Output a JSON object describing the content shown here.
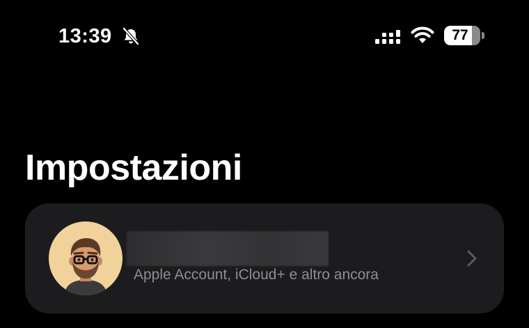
{
  "status_bar": {
    "time": "13:39",
    "silent_icon": "bell-slash-icon",
    "signal_icon": "cellular-signal-icon",
    "wifi_icon": "wifi-icon",
    "battery_level": "77",
    "battery_fraction": 0.77
  },
  "header": {
    "title": "Impostazioni"
  },
  "account": {
    "name_redacted": true,
    "subtitle": "Apple Account, iCloud+ e altro ancora",
    "avatar_icon": "memoji-avatar",
    "chevron_icon": "chevron-right-icon"
  },
  "colors": {
    "background": "#000000",
    "card": "#1c1c1e",
    "secondary_text": "#8e8e93",
    "avatar_bg": "#f0d29a"
  }
}
